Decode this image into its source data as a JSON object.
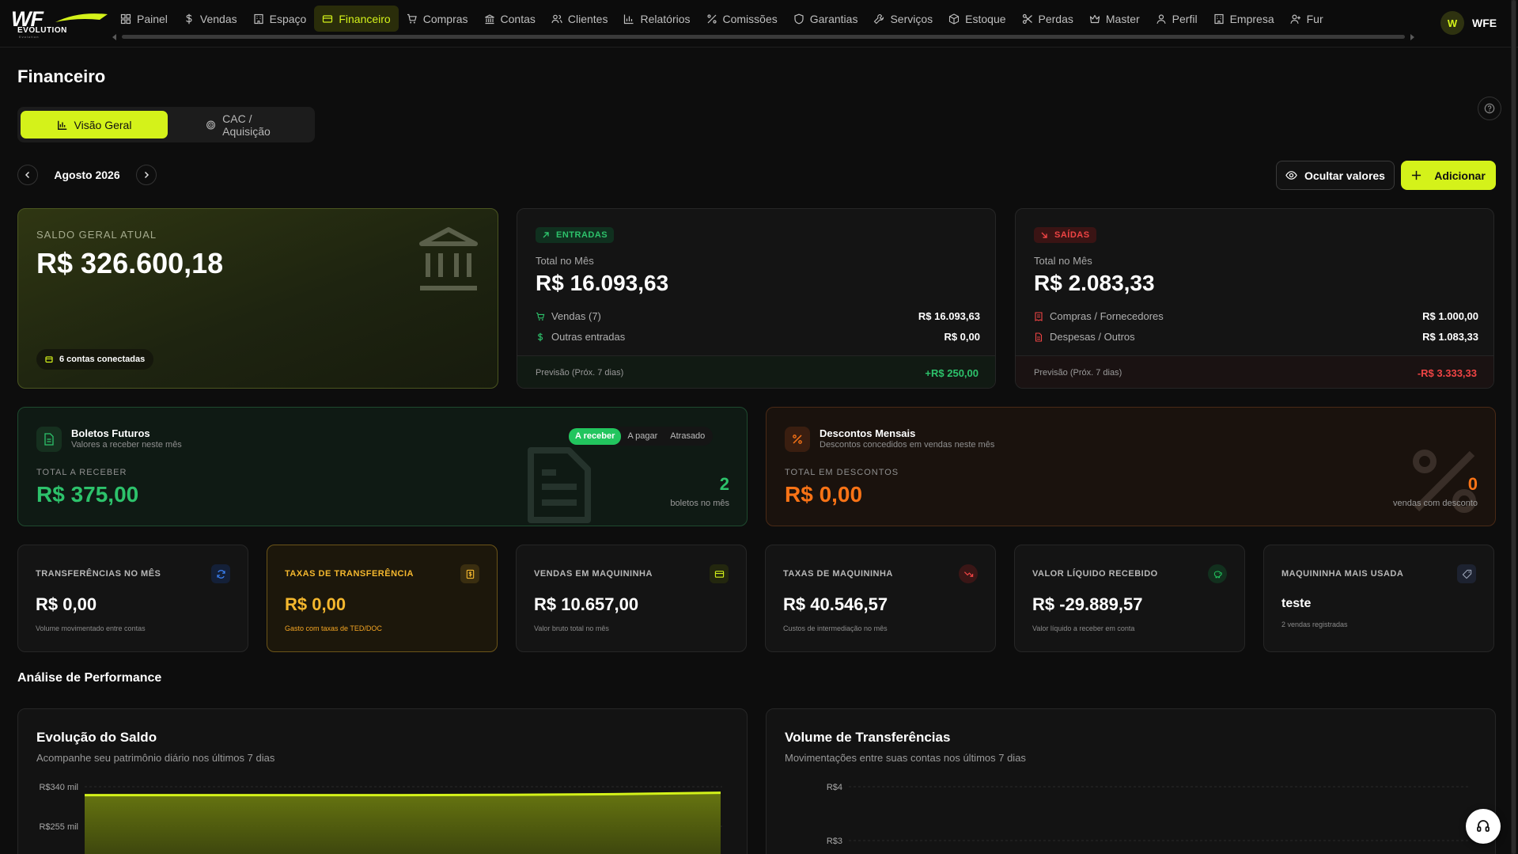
{
  "brand": {
    "logo_text": "WF",
    "logo_sub": "EVOLUTION",
    "tagline": "Evolution",
    "accent": "#d4f21a"
  },
  "nav": [
    {
      "label": "Painel",
      "icon": "grid-icon"
    },
    {
      "label": "Vendas",
      "icon": "dollar-icon"
    },
    {
      "label": "Espaço",
      "icon": "building-icon"
    },
    {
      "label": "Financeiro",
      "icon": "card-icon",
      "active": true
    },
    {
      "label": "Compras",
      "icon": "cart-icon"
    },
    {
      "label": "Contas",
      "icon": "bank-icon"
    },
    {
      "label": "Clientes",
      "icon": "users-icon"
    },
    {
      "label": "Relatórios",
      "icon": "bar-chart-icon"
    },
    {
      "label": "Comissões",
      "icon": "percent-icon"
    },
    {
      "label": "Garantias",
      "icon": "shield-icon"
    },
    {
      "label": "Serviços",
      "icon": "wrench-icon"
    },
    {
      "label": "Estoque",
      "icon": "box-icon"
    },
    {
      "label": "Perdas",
      "icon": "scissors-icon"
    },
    {
      "label": "Master",
      "icon": "crown-icon"
    },
    {
      "label": "Perfil",
      "icon": "user-icon"
    },
    {
      "label": "Empresa",
      "icon": "building-icon"
    },
    {
      "label": "Fur",
      "icon": "user-plus-icon"
    }
  ],
  "user": {
    "initial": "W",
    "name": "WFE"
  },
  "page": {
    "title": "Financeiro"
  },
  "tabs": [
    {
      "label": "Visão Geral",
      "active": true
    },
    {
      "label": "CAC / Aquisição",
      "active": false
    }
  ],
  "period": {
    "label": "Agosto 2026"
  },
  "actions": {
    "hide_values": "Ocultar valores",
    "add": "Adicionar"
  },
  "saldo": {
    "label": "SALDO GERAL ATUAL",
    "value": "R$ 326.600,18",
    "accounts_badge": "6 contas conectadas"
  },
  "entradas": {
    "pill": "ENTRADAS",
    "sub": "Total no Mês",
    "value": "R$ 16.093,63",
    "rows": [
      {
        "label": "Vendas (7)",
        "amount": "R$ 16.093,63"
      },
      {
        "label": "Outras entradas",
        "amount": "R$ 0,00"
      }
    ],
    "forecast_label": "Previsão (Próx. 7 dias)",
    "forecast_value": "+R$ 250,00"
  },
  "saidas": {
    "pill": "SAÍDAS",
    "sub": "Total no Mês",
    "value": "R$ 2.083,33",
    "rows": [
      {
        "label": "Compras / Fornecedores",
        "amount": "R$ 1.000,00"
      },
      {
        "label": "Despesas / Outros",
        "amount": "R$ 1.083,33"
      }
    ],
    "forecast_label": "Previsão (Próx. 7 dias)",
    "forecast_value": "-R$ 3.333,33"
  },
  "boletos": {
    "title": "Boletos Futuros",
    "desc": "Valores a receber neste mês",
    "segments": [
      "A receber",
      "A pagar",
      "Atrasado"
    ],
    "total_label": "TOTAL A RECEBER",
    "total": "R$ 375,00",
    "count": "2",
    "count_label": "boletos no mês"
  },
  "descontos": {
    "title": "Descontos Mensais",
    "desc": "Descontos concedidos em vendas neste mês",
    "total_label": "TOTAL EM DESCONTOS",
    "total": "R$ 0,00",
    "count": "0",
    "count_label": "vendas com desconto"
  },
  "stats": [
    {
      "title": "TRANSFERÊNCIAS NO MÊS",
      "value": "R$ 0,00",
      "note": "Volume movimentado entre contas",
      "icon": "refresh-icon",
      "color": "#3b82f6"
    },
    {
      "title": "TAXAS DE TRANSFERÊNCIA",
      "value": "R$ 0,00",
      "note": "Gasto com taxas de TED/DOC",
      "icon": "receipt-icon",
      "color": "#f5b82e"
    },
    {
      "title": "VENDAS EM MAQUININHA",
      "value": "R$ 10.657,00",
      "note": "Valor bruto total no mês",
      "icon": "card-icon",
      "color": "#d4f21a"
    },
    {
      "title": "TAXAS DE MAQUININHA",
      "value": "R$ 40.546,57",
      "note": "Custos de intermediação no mês",
      "icon": "trend-down-icon",
      "color": "#ef4444"
    },
    {
      "title": "VALOR LÍQUIDO RECEBIDO",
      "value": "R$ -29.889,57",
      "note": "Valor líquido a receber em conta",
      "icon": "piggy-bank-icon",
      "color": "#22c55e"
    },
    {
      "title": "MAQUININHA MAIS USADA",
      "value": "teste",
      "note": "2 vendas registradas",
      "icon": "tag-icon",
      "color": "#9aa3b5"
    }
  ],
  "performance": {
    "title": "Análise de Performance"
  },
  "chart_data": [
    {
      "type": "area",
      "title": "Evolução do Saldo",
      "subtitle": "Acompanhe seu patrimônio diário nos últimos 7 dias",
      "y_ticks": [
        "R$340 mil",
        "R$255 mil"
      ],
      "color": "#d4f21a",
      "series": [
        {
          "values": [
            322,
            322,
            322,
            322,
            322.5,
            324,
            327
          ]
        }
      ]
    },
    {
      "type": "line",
      "title": "Volume de Transferências",
      "subtitle": "Movimentações entre suas contas nos últimos 7 dias",
      "y_ticks": [
        "R$4",
        "R$3"
      ],
      "color": "#3b82f6",
      "series": []
    }
  ]
}
